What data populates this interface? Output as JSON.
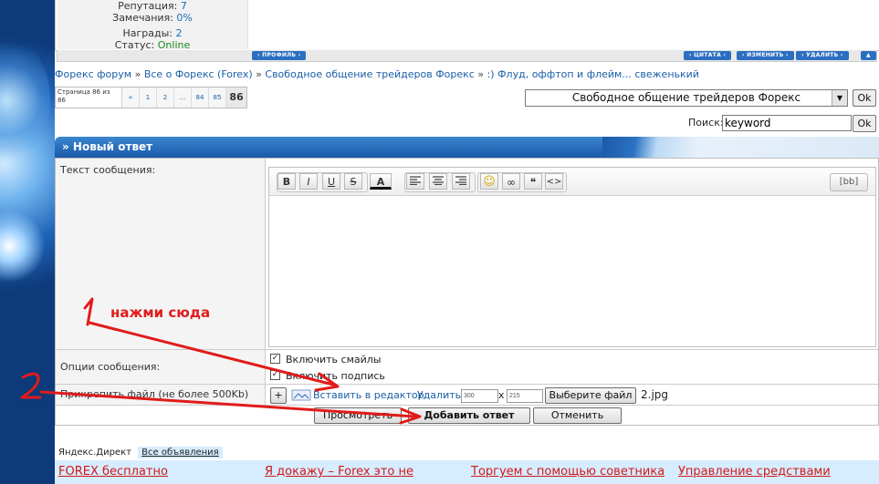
{
  "user": {
    "reputation_label": "Репутация:",
    "reputation_value": "7",
    "remarks_label": "Замечания:",
    "remarks_value": "0%",
    "awards_label": "Награды:",
    "awards_value": "2",
    "status_label": "Статус:",
    "status_value": "Online"
  },
  "post_buttons": {
    "profile": "› ПРОФИЛЬ ‹",
    "quote": "› ЦИТАТА ‹",
    "edit": "› ИЗМЕНИТЬ ‹",
    "delete": "› УДАЛИТЬ ‹",
    "top": "▲"
  },
  "breadcrumb": {
    "items": [
      "Форекс форум",
      "Все о Форекс (Forex)",
      "Свободное общение трейдеров Форекс",
      ":) Флуд, оффтоп и флейм... свеженький"
    ],
    "sep": " » "
  },
  "pager": {
    "info": "Страница 86 из 86",
    "pages": [
      "«",
      "1",
      "2",
      "...",
      "84",
      "85"
    ],
    "current": "86"
  },
  "forum_select": {
    "value": "Свободное общение трейдеров Форекс",
    "arrow": "▼",
    "ok": "Ok"
  },
  "search": {
    "label": "Поиск:",
    "value": "keyword",
    "ok": "Ok"
  },
  "reply": {
    "title": "» Новый ответ",
    "text_label": "Текст сообщения:",
    "options_label": "Опции сообщения:",
    "attach_label": "Прикрепить файл (не более 500Kb)",
    "toolbar": {
      "bold": "B",
      "italic": "I",
      "underline": "U",
      "strike": "S",
      "color": "A",
      "smile": "☺",
      "link": "∞",
      "quote": "❝",
      "code": "<>",
      "bb": "[bb]"
    },
    "opt_smiles": "Включить смайлы",
    "opt_signature": "Включить подпись",
    "attach": {
      "plus": "+",
      "insert": "Вставить в редактор",
      "delete": "Удалить",
      "width": "300",
      "x": "x",
      "height": "215",
      "choose": "Выберите файл",
      "file": "2.jpg"
    },
    "buttons": {
      "preview": "Просмотреть",
      "submit": "Добавить ответ",
      "cancel": "Отменить"
    }
  },
  "annotation": {
    "step1": "1",
    "step1_text": "нажми сюда",
    "step2": "2",
    "color": "#e01b1b"
  },
  "ads": {
    "tab1": "Яндекс.Директ",
    "tab2": "Все объявления",
    "items": [
      "FOREX бесплатно",
      "Я докажу – Forex это не",
      "Торгуем с помощью советника",
      "Управление средствами"
    ]
  }
}
